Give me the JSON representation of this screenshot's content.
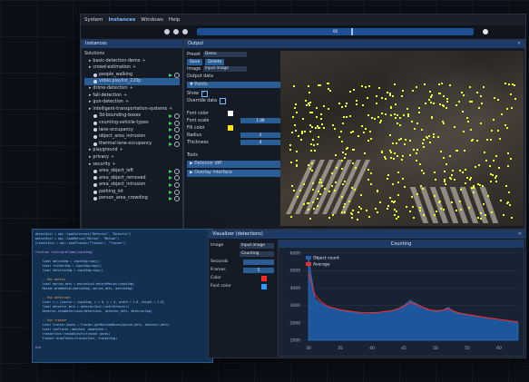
{
  "menu": [
    "System",
    "Instances",
    "Windows",
    "Help"
  ],
  "timeline": {
    "label": "00"
  },
  "instances_panel": {
    "tab": "Instances",
    "root": "Solutions",
    "items": [
      {
        "label": "basic-detection-demo",
        "depth": 1,
        "type": "folder"
      },
      {
        "label": "crowd-estimation",
        "depth": 1,
        "type": "folder"
      },
      {
        "label": "people_walking",
        "depth": 2,
        "type": "item",
        "running": true
      },
      {
        "label": "video.playlist_220p",
        "depth": 2,
        "type": "item",
        "selected": true
      },
      {
        "label": "drone-detection",
        "depth": 1,
        "type": "folder"
      },
      {
        "label": "fall-detection",
        "depth": 1,
        "type": "folder"
      },
      {
        "label": "gun-detection",
        "depth": 1,
        "type": "folder"
      },
      {
        "label": "intelligent-transportation-systems",
        "depth": 1,
        "type": "folder"
      },
      {
        "label": "3d-bounding-boxes",
        "depth": 2,
        "type": "item",
        "running": true
      },
      {
        "label": "counting-vehicle-types",
        "depth": 2,
        "type": "item",
        "running": true
      },
      {
        "label": "lane-occupancy",
        "depth": 2,
        "type": "item",
        "running": true
      },
      {
        "label": "object_area_intrusion",
        "depth": 2,
        "type": "item",
        "running": true
      },
      {
        "label": "thermal-lane-occupancy",
        "depth": 2,
        "type": "item",
        "running": true
      },
      {
        "label": "playground",
        "depth": 1,
        "type": "folder"
      },
      {
        "label": "privacy",
        "depth": 1,
        "type": "folder"
      },
      {
        "label": "security",
        "depth": 1,
        "type": "folder"
      },
      {
        "label": "area_object_left",
        "depth": 2,
        "type": "item",
        "running": true
      },
      {
        "label": "area_object_removed",
        "depth": 2,
        "type": "item",
        "running": true
      },
      {
        "label": "area_object_intrusion",
        "depth": 2,
        "type": "item",
        "running": true
      },
      {
        "label": "parking_lot",
        "depth": 2,
        "type": "item",
        "running": true
      },
      {
        "label": "person_area_crowding",
        "depth": 2,
        "type": "item",
        "running": true
      }
    ]
  },
  "output_panel": {
    "tab": "Output",
    "preset_label": "Preset",
    "preset_value": "Demo",
    "save": "Save",
    "delete": "Delete",
    "image_label": "Image",
    "image_value": "Input image",
    "output_data": "Output data",
    "points": "Points",
    "show": "Show",
    "override": "Override data",
    "font_color": "Font color",
    "font_scale": "Font scale",
    "font_scale_value": "1.00",
    "fill_color": "Fill color",
    "radius": "Radius",
    "radius_value": "1",
    "thickness": "Thickness",
    "thickness_value": "4",
    "tools": "Tools",
    "detector_diff": "Detector diff",
    "overlay_interface": "Overlay interface",
    "colors": {
      "font": "#ffffff",
      "fill": "#ffe600"
    }
  },
  "code_editor": {
    "lines": [
      {
        "t": "detectInst = api::loadInference(\"Detector\", \"Detector\")",
        "c": ""
      },
      {
        "t": "motionInst = api::loadMotion(\"Motion\", \"Motion\")",
        "c": ""
      },
      {
        "t": "trackerInst = api::loadTracker(\"Tracker\", \"Tracker\")",
        "c": ""
      },
      {
        "t": "",
        "c": ""
      },
      {
        "t": "function runSingleFrame(inputImg)",
        "c": "kw"
      },
      {
        "t": "",
        "c": ""
      },
      {
        "t": "    local motionImg = inputImg:copy()",
        "c": ""
      },
      {
        "t": "    local trackerImg = inputImg:copy()",
        "c": ""
      },
      {
        "t": "    local detectorImg = inputImg:copy()",
        "c": ""
      },
      {
        "t": "",
        "c": ""
      },
      {
        "t": "    -- Run motion",
        "c": "cm"
      },
      {
        "t": "    local motion_dets = motionInst:detectMotion(inputImg)",
        "c": ""
      },
      {
        "t": "    Motion.drawMotion(motionImg, motion_dets, motionImg)",
        "c": ""
      },
      {
        "t": "",
        "c": ""
      },
      {
        "t": "    -- Run detection",
        "c": "cm"
      },
      {
        "t": "    local r = {source = inputImg, x = 0, y = 0, width = 1.0, height = 1.0}",
        "c": ""
      },
      {
        "t": "    local detector_dets = detectorInst:runInference(r)",
        "c": ""
      },
      {
        "t": "    Detector.drawDetections(detections, detector_dets, detectorImg)",
        "c": ""
      },
      {
        "t": "",
        "c": ""
      },
      {
        "t": "    -- Run tracker",
        "c": "cm"
      },
      {
        "t": "    local tracker_boxes = Tracker.getMatchedBoxes(motion_dets, detector_dets)",
        "c": ""
      },
      {
        "t": "    local newTracks, matched, unmatched =",
        "c": ""
      },
      {
        "t": "    trackerInst:trackObjects(tracker_boxes)",
        "c": ""
      },
      {
        "t": "    Tracker.drawTracks(trackerInst, trackerImg)",
        "c": ""
      },
      {
        "t": "",
        "c": ""
      },
      {
        "t": "end",
        "c": "kw"
      }
    ]
  },
  "viz_panel": {
    "tab": "Visualizer (detections)",
    "fields": [
      {
        "label": "Image",
        "value": "Input image"
      },
      {
        "label": "",
        "value": "Counting"
      },
      {
        "label": "Seconds",
        "value": ""
      },
      {
        "label": "Frames",
        "value": "5"
      },
      {
        "label": "Color",
        "value": ""
      },
      {
        "label": "Font color",
        "value": ""
      }
    ],
    "swatch_colors": [
      "#ff2a2a",
      "#2a9bff"
    ]
  },
  "chart_data": {
    "type": "area",
    "title": "Counting",
    "x": [
      30,
      31,
      32,
      33,
      34,
      35,
      36,
      37,
      38,
      39,
      40,
      41,
      42,
      43,
      44,
      45,
      46,
      47,
      48,
      49,
      50,
      51,
      52,
      53,
      54,
      55,
      56,
      57,
      58,
      59,
      60,
      61,
      62,
      63
    ],
    "series": [
      {
        "name": "Object count",
        "values": [
          5800,
          3400,
          3100,
          2900,
          2850,
          2700,
          2650,
          2600,
          2550,
          2500,
          2550,
          2600,
          2650,
          2700,
          2800,
          3000,
          3300,
          3100,
          2900,
          2700,
          2650,
          2700,
          2900,
          2600,
          2500,
          2450,
          2400,
          2350,
          2300,
          2250,
          2200,
          2150,
          2100,
          2050
        ],
        "color": "#1f5fae"
      },
      {
        "name": "Average",
        "values": [
          4900,
          3600,
          3200,
          2950,
          2850,
          2750,
          2700,
          2650,
          2600,
          2580,
          2580,
          2600,
          2650,
          2700,
          2780,
          2950,
          3150,
          3050,
          2900,
          2760,
          2700,
          2720,
          2820,
          2650,
          2550,
          2480,
          2420,
          2360,
          2300,
          2250,
          2200,
          2150,
          2100,
          2050
        ],
        "color": "#ff2a2a"
      }
    ],
    "xlim": [
      29,
      63
    ],
    "ylim": [
      1000,
      6000
    ],
    "yticks": [
      1000,
      2000,
      3000,
      4000,
      5000,
      6000
    ],
    "xticks": [
      30,
      35,
      40,
      45,
      50,
      55,
      60
    ],
    "legend": "top-left"
  }
}
